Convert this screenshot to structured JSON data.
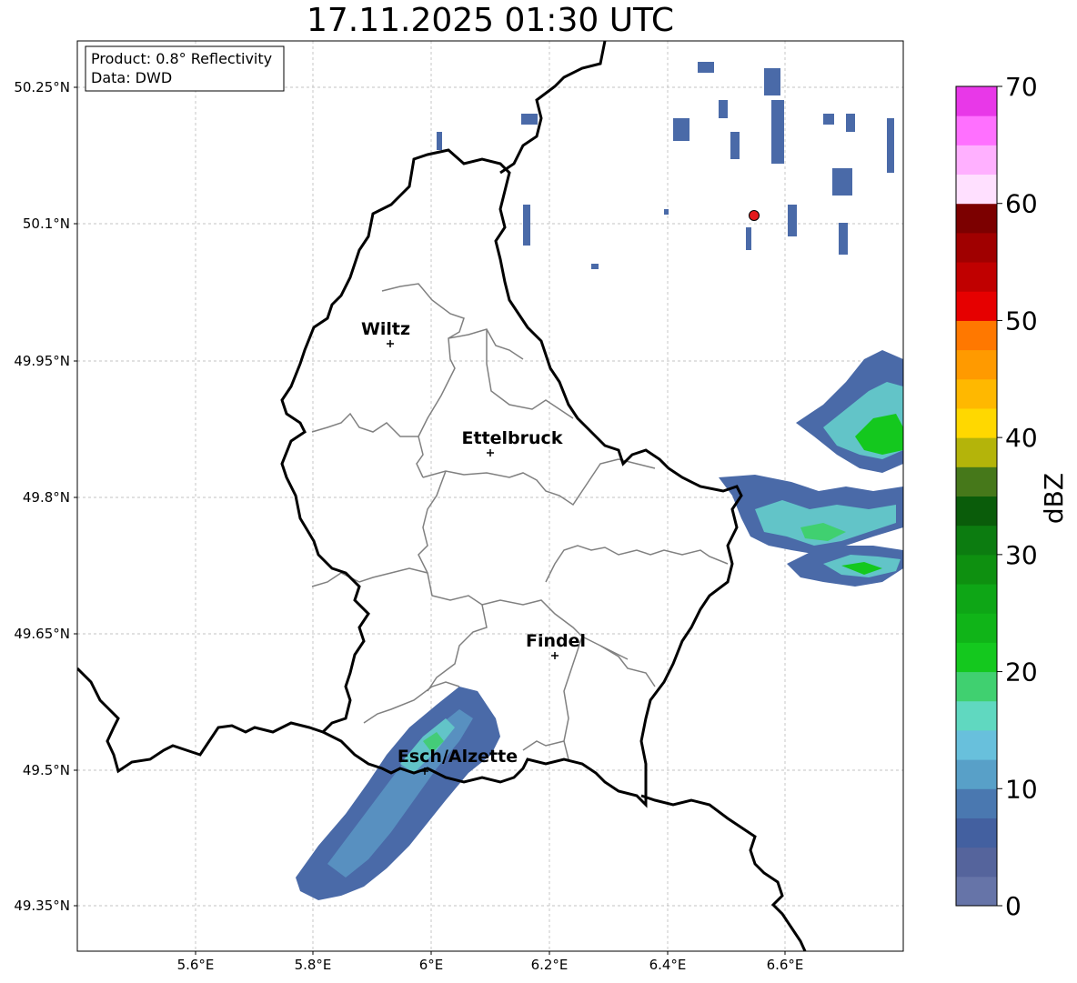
{
  "title": "17.11.2025 01:30 UTC",
  "info_box": {
    "product": "Product: 0.8° Reflectivity",
    "data": "Data: DWD"
  },
  "axes": {
    "x_ticks": [
      "5.6°E",
      "5.8°E",
      "6°E",
      "6.2°E",
      "6.4°E",
      "6.6°E"
    ],
    "y_ticks": [
      "50.25°N",
      "50.1°N",
      "49.95°N",
      "49.8°N",
      "49.65°N",
      "49.5°N",
      "49.35°N"
    ]
  },
  "cities": [
    {
      "name": "Wiltz"
    },
    {
      "name": "Ettelbruck"
    },
    {
      "name": "Findel"
    },
    {
      "name": "Esch/Alzette"
    }
  ],
  "radar_site_color": "#e31a1c",
  "colorbar": {
    "label": "dBZ",
    "ticks": [
      "0",
      "10",
      "20",
      "30",
      "40",
      "50",
      "60",
      "70"
    ],
    "colors": [
      "#6674a8",
      "#55649c",
      "#4360a0",
      "#4a78b0",
      "#58a0c8",
      "#68c0dc",
      "#60d8c0",
      "#40d070",
      "#14c81e",
      "#10b418",
      "#0ea616",
      "#0e9010",
      "#0c7c10",
      "#0a5c0a",
      "#46781a",
      "#b4b40a",
      "#ffd800",
      "#ffb800",
      "#ff9a00",
      "#ff7800",
      "#e60000",
      "#c00000",
      "#a00000",
      "#7c0000",
      "#ffe0ff",
      "#ffb0ff",
      "#ff70ff",
      "#e838e8"
    ]
  }
}
